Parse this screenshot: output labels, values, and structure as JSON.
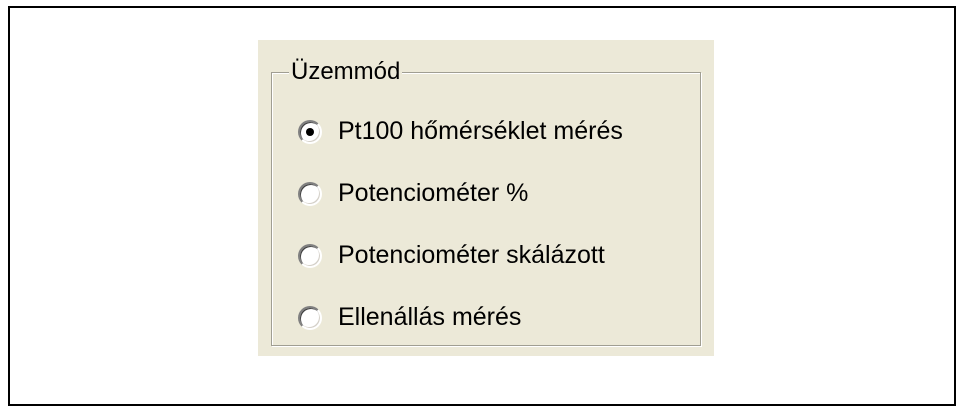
{
  "groupbox": {
    "title": "Üzemmód",
    "options": [
      {
        "label": "Pt100 hőmérséklet mérés",
        "checked": true
      },
      {
        "label": "Potenciométer %",
        "checked": false
      },
      {
        "label": "Potenciométer skálázott",
        "checked": false
      },
      {
        "label": "Ellenállás mérés",
        "checked": false
      }
    ]
  },
  "colors": {
    "panel_background": "#ece9d8",
    "groupbox_border": "#a09e92",
    "frame_border": "#000000"
  }
}
